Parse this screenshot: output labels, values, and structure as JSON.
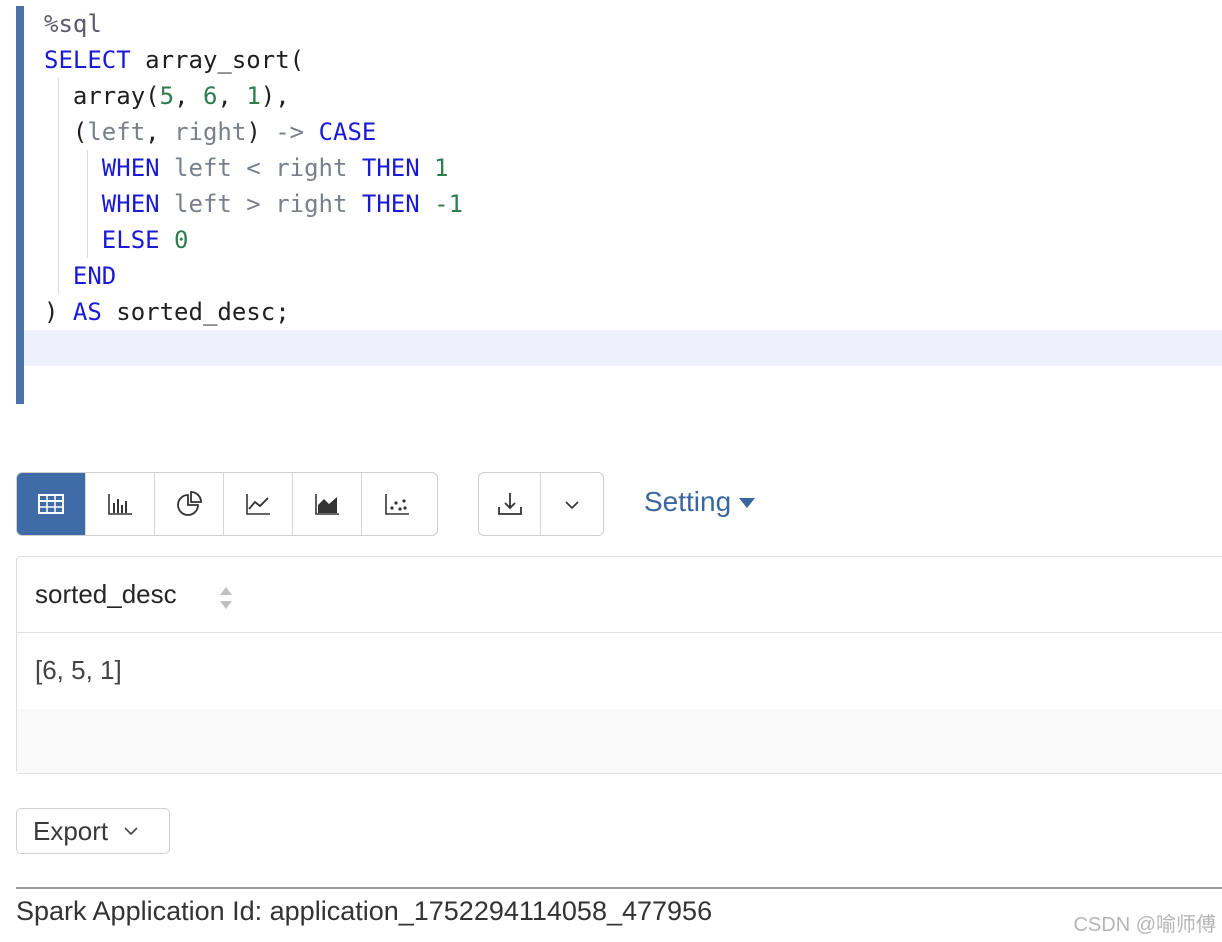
{
  "editor": {
    "lines": [
      {
        "magic": "%sql"
      },
      {
        "kw": "SELECT",
        "fn": " array_sort("
      },
      {
        "fn": "array(",
        "n1": "5",
        "s1": ", ",
        "n2": "6",
        "s2": ", ",
        "n3": "1",
        "end": "),"
      },
      {
        "p1": "(",
        "v1": "left",
        "s1": ", ",
        "v2": "right",
        "p2": ")",
        "arrow": " -> ",
        "kw": "CASE"
      },
      {
        "kw1": "WHEN",
        "v1": " left < right ",
        "kw2": "THEN",
        "n": " 1"
      },
      {
        "kw1": "WHEN",
        "v1": " left > right ",
        "kw2": "THEN",
        "n": " -1"
      },
      {
        "kw": "ELSE",
        "n": " 0"
      },
      {
        "kw": "END"
      },
      {
        "p": ") ",
        "kw": "AS",
        "fn": " sorted_desc;"
      }
    ]
  },
  "toolbar": {
    "vis_buttons": [
      "table-icon",
      "bar-chart-icon",
      "pie-chart-icon",
      "line-chart-icon",
      "area-chart-icon",
      "scatter-chart-icon"
    ],
    "download_icon": "download-icon",
    "dropdown_icon": "chevron-down-icon",
    "setting_label": "Setting",
    "accent": "#3f6ca6"
  },
  "table": {
    "columns": [
      "sorted_desc"
    ],
    "rows": [
      [
        "[6, 5, 1]"
      ]
    ]
  },
  "export": {
    "label": "Export"
  },
  "footer": {
    "spark_app_id": "Spark Application Id: application_1752294114058_477956",
    "watermark": "CSDN @喻师傅"
  }
}
